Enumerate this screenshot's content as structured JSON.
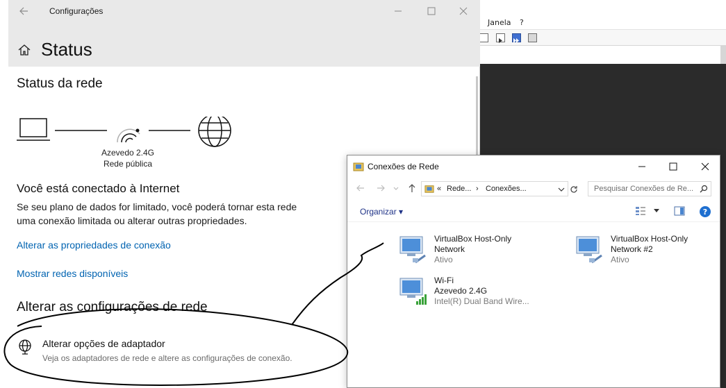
{
  "background_app": {
    "menu": [
      "Janela",
      "?"
    ]
  },
  "settings": {
    "app_title": "Configurações",
    "page_title": "Status",
    "network_status_heading": "Status da rede",
    "wifi_name": "Azevedo 2.4G",
    "network_type": "Rede pública",
    "connected_heading": "Você está conectado à Internet",
    "connected_body": "Se seu plano de dados for limitado, você poderá tornar esta rede uma conexão limitada ou alterar outras propriedades.",
    "link_properties": "Alterar as propriedades de conexão",
    "link_networks": "Mostrar redes disponíveis",
    "change_heading": "Alterar as configurações de rede",
    "adapter_title": "Alterar opções de adaptador",
    "adapter_desc": "Veja os adaptadores de rede e altere as configurações de conexão."
  },
  "network_connections": {
    "title": "Conexões de Rede",
    "address_prefix": "«",
    "address_1": "Rede...",
    "address_sep": "›",
    "address_2": "Conexões...",
    "search_placeholder": "Pesquisar Conexões de Re...",
    "organize_label": "Organizar",
    "items": [
      {
        "name_line1": "VirtualBox Host-Only",
        "name_line2": "Network",
        "status": "Ativo"
      },
      {
        "name_line1": "VirtualBox Host-Only",
        "name_line2": "Network #2",
        "status": "Ativo"
      },
      {
        "name_line1": "Wi-Fi",
        "name_line2": "Azevedo 2.4G",
        "status": "Intel(R) Dual Band Wire..."
      }
    ]
  }
}
